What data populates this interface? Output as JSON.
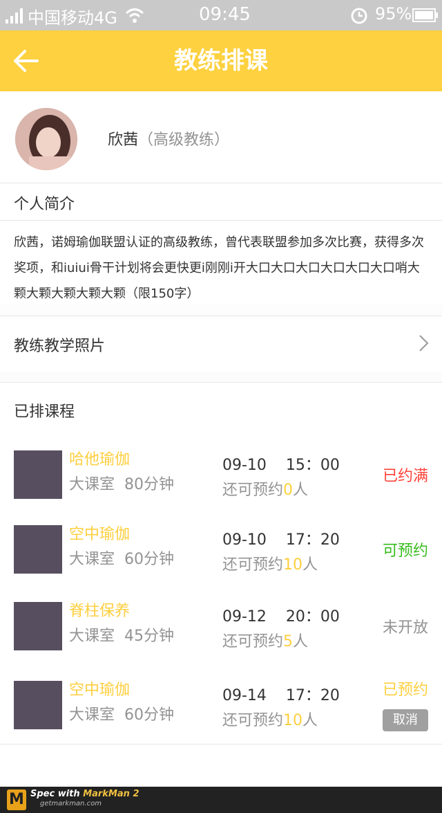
{
  "status_bar": {
    "carrier": "中国移动4G",
    "time": "09:45",
    "battery": "95%"
  },
  "header": {
    "title": "教练排课",
    "background": "#fdd13f"
  },
  "coach": {
    "name": "欣茜",
    "level": "（高级教练）"
  },
  "profile": {
    "section_title": "个人简介",
    "intro": "欣茜，诺姆瑜伽联盟认证的高级教练，曾代表联盟参加多次比赛，获得多次奖项，和iuiui骨干计划将会更快更i刚刚i开大口大口大口大口大口大口哨大颗大颗大颗大颗大颗（限150字）"
  },
  "photos": {
    "label": "教练教学照片"
  },
  "scheduled": {
    "title": "已排课程",
    "courses": [
      {
        "name": "哈他瑜伽",
        "room": "大课室",
        "duration": "80分钟",
        "date": "09-10",
        "time": "15：00",
        "avail_prefix": "还可预约",
        "avail_num": "0",
        "avail_suffix": "人",
        "status": "已约满",
        "status_color": "#ff4138"
      },
      {
        "name": "空中瑜伽",
        "room": "大课室",
        "duration": "60分钟",
        "date": "09-10",
        "time": "17：20",
        "avail_prefix": "还可预约",
        "avail_num": "10",
        "avail_suffix": "人",
        "status": "可预约",
        "status_color": "#37bc1d"
      },
      {
        "name": "脊柱保养",
        "room": "大课室",
        "duration": "45分钟",
        "date": "09-12",
        "time": "20：00",
        "avail_prefix": "还可预约",
        "avail_num": "5",
        "avail_suffix": "人",
        "status": "未开放",
        "status_color": "#939393"
      },
      {
        "name": "空中瑜伽",
        "room": "大课室",
        "duration": "60分钟",
        "date": "09-14",
        "time": "17：20",
        "avail_prefix": "还可预约",
        "avail_num": "10",
        "avail_suffix": "人",
        "status": "已预约",
        "status_color": "#fecf3f",
        "cancel_label": "取消"
      }
    ]
  },
  "footer": {
    "spec_with": "Spec with",
    "brand": "MarkMan 2",
    "site": "getmarkman.com",
    "logo_letter": "M"
  }
}
